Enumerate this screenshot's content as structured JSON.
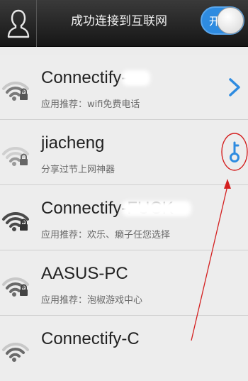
{
  "header": {
    "title": "成功连接到互联网",
    "toggle_label": "开",
    "toggle_on": true,
    "accent_color": "#2e8be0"
  },
  "networks": [
    {
      "ssid": "Connectify-",
      "subtitle": "应用推荐：wifi免费电话",
      "icon": "wifi-locked-icon",
      "action": "chevron-right-icon",
      "signal": "medium"
    },
    {
      "ssid": "jiacheng",
      "subtitle": "分享过节上网神器",
      "icon": "wifi-locked-icon",
      "action": "key-icon",
      "signal": "weak"
    },
    {
      "ssid": "Connectify-FUCK",
      "subtitle": "应用推荐：欢乐、癞子任您选择",
      "icon": "wifi-locked-icon",
      "action": "",
      "signal": "strong"
    },
    {
      "ssid": "AASUS-PC",
      "subtitle": "应用推荐：泡椒游戏中心",
      "icon": "wifi-locked-icon",
      "action": "",
      "signal": "medium"
    },
    {
      "ssid": "Connectify-C",
      "subtitle": "",
      "icon": "wifi-locked-icon",
      "action": "",
      "signal": "medium"
    }
  ],
  "annotation_color": "#d42020"
}
